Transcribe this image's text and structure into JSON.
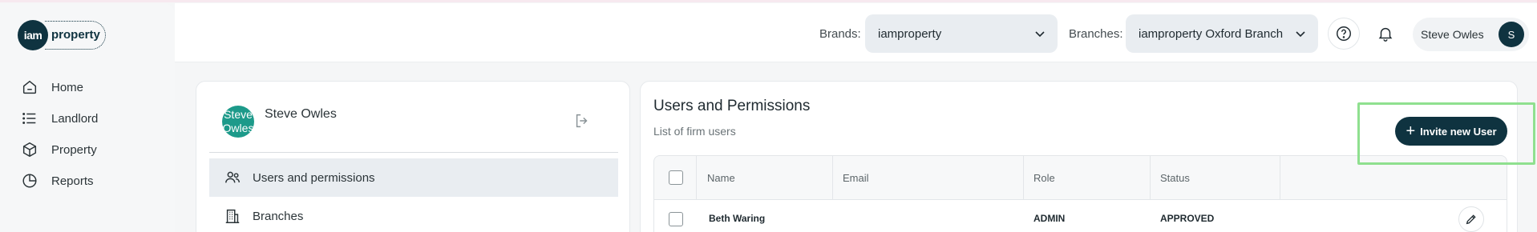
{
  "logo": {
    "mark": "iam",
    "word": "property"
  },
  "sidebar": {
    "items": [
      {
        "label": "Home",
        "icon": "home-icon"
      },
      {
        "label": "Landlord",
        "icon": "list-icon"
      },
      {
        "label": "Property",
        "icon": "cube-icon"
      },
      {
        "label": "Reports",
        "icon": "pie-chart-icon"
      }
    ]
  },
  "header": {
    "brands_label": "Brands:",
    "brands_value": "iamproperty",
    "branches_label": "Branches:",
    "branches_value": "iamproperty Oxford Branch",
    "user_name": "Steve Owles",
    "user_initial": "S"
  },
  "profile": {
    "avatar_text": "Steve Owles",
    "name": "Steve Owles",
    "menu": [
      {
        "label": "Users and permissions",
        "icon": "users-icon",
        "active": true
      },
      {
        "label": "Branches",
        "icon": "building-icon",
        "active": false
      }
    ]
  },
  "users": {
    "title": "Users and Permissions",
    "subtitle": "List of firm users",
    "invite_label": "Invite new User",
    "columns": [
      "Name",
      "Email",
      "Role",
      "Status"
    ],
    "rows": [
      {
        "name": "Beth Waring",
        "email": "",
        "role": "ADMIN",
        "status": "APPROVED"
      }
    ]
  },
  "colors": {
    "primary": "#0f3340",
    "avatar_teal": "#1d9a8a",
    "highlight": "#8fe08f",
    "select_bg": "#e9edf1"
  }
}
